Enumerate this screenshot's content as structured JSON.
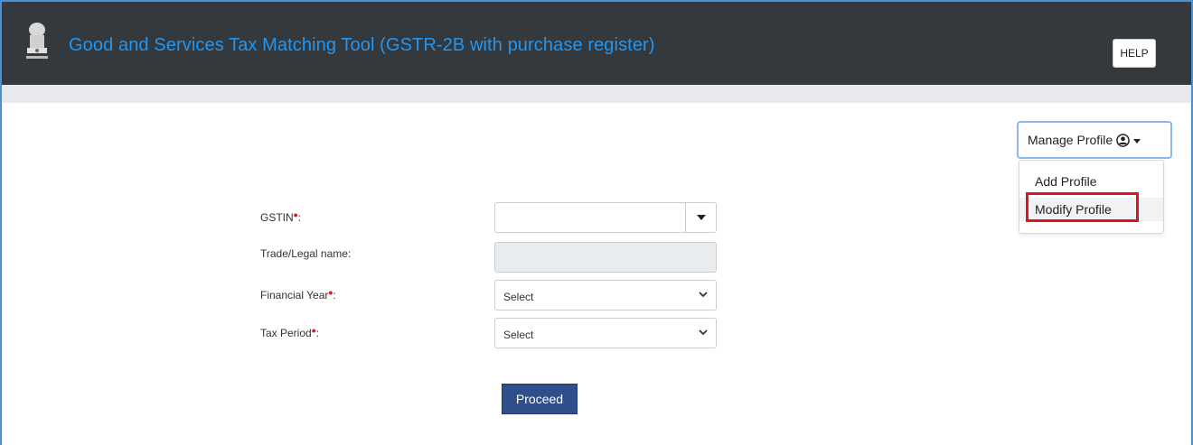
{
  "header": {
    "title": "Good and Services Tax Matching Tool (GSTR-2B with purchase register)",
    "help_label": "HELP",
    "logo_icon": "national-emblem-icon"
  },
  "profile_menu": {
    "button_label": "Manage Profile",
    "button_icon": "user-circle-icon",
    "items": [
      {
        "label": "Add Profile"
      },
      {
        "label": "Modify Profile",
        "highlighted": true
      }
    ],
    "highlight_color": "#e0141e"
  },
  "form": {
    "gstin": {
      "label": "GSTIN",
      "required_mark": "•",
      "suffix": ":",
      "value": ""
    },
    "trade_name": {
      "label": "Trade/Legal name:",
      "value": ""
    },
    "financial_year": {
      "label": "Financial Year",
      "required_mark": "•",
      "suffix": ":",
      "value": "Select"
    },
    "tax_period": {
      "label": "Tax Period",
      "required_mark": "•",
      "suffix": ":",
      "value": "Select"
    },
    "proceed_label": "Proceed"
  },
  "colors": {
    "header_bg": "#34393e",
    "title_color": "#2196f3",
    "proceed_bg": "#2f4f8a",
    "required_color": "#e0141e"
  }
}
